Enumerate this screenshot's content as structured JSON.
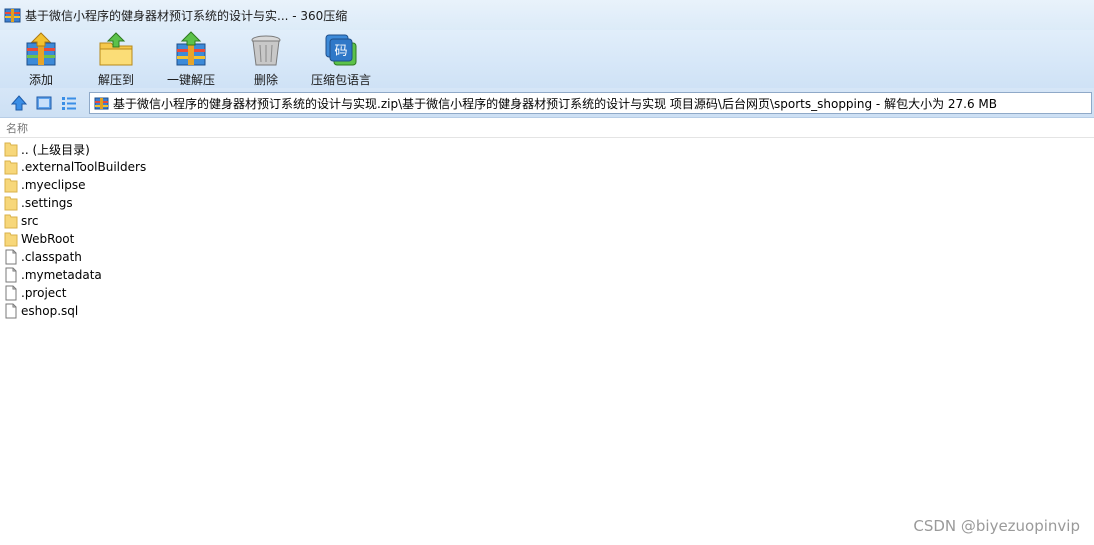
{
  "window": {
    "title": "基于微信小程序的健身器材预订系统的设计与实... - 360压缩"
  },
  "toolbar": {
    "add_label": "添加",
    "extract_to_label": "解压到",
    "one_click_extract_label": "一键解压",
    "delete_label": "删除",
    "archive_language_label": "压缩包语言",
    "language_icon_glyph": "码"
  },
  "addressbar": {
    "path": "基于微信小程序的健身器材预订系统的设计与实现.zip\\基于微信小程序的健身器材预订系统的设计与实现 项目源码\\后台网页\\sports_shopping - 解包大小为 27.6 MB"
  },
  "list": {
    "column_name": "名称",
    "items": [
      {
        "name": ".. (上级目录)",
        "type": "folder"
      },
      {
        "name": ".externalToolBuilders",
        "type": "folder"
      },
      {
        "name": ".myeclipse",
        "type": "folder"
      },
      {
        "name": ".settings",
        "type": "folder"
      },
      {
        "name": "src",
        "type": "folder"
      },
      {
        "name": "WebRoot",
        "type": "folder"
      },
      {
        "name": ".classpath",
        "type": "file"
      },
      {
        "name": ".mymetadata",
        "type": "file"
      },
      {
        "name": ".project",
        "type": "file"
      },
      {
        "name": "eshop.sql",
        "type": "file"
      }
    ]
  },
  "watermark": "CSDN @biyezuopinvip",
  "colors": {
    "folder": "#f7d77a",
    "accent": "#3a7bd5"
  }
}
